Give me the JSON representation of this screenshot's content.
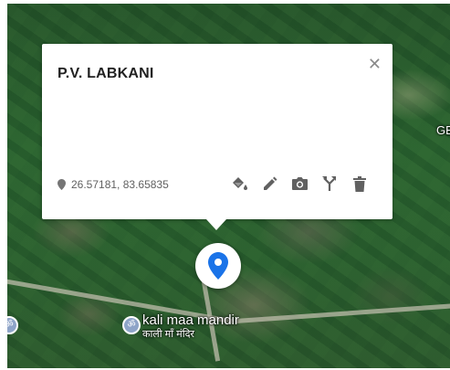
{
  "popup": {
    "title": "P.V. LABKANI",
    "coordinates": "26.57181, 83.65835",
    "close_icon": "close-icon",
    "actions": [
      {
        "name": "paint-bucket-icon"
      },
      {
        "name": "pencil-icon"
      },
      {
        "name": "camera-icon"
      },
      {
        "name": "directions-icon"
      },
      {
        "name": "trash-icon"
      }
    ]
  },
  "map": {
    "edge_label": "GE",
    "place": {
      "name": "kali maa mandir",
      "name_hindi": "काली माँ मंदिर",
      "icon": "temple-om-icon"
    },
    "marker_icon": "map-pin-icon",
    "marker_color": "#1a73e8"
  }
}
